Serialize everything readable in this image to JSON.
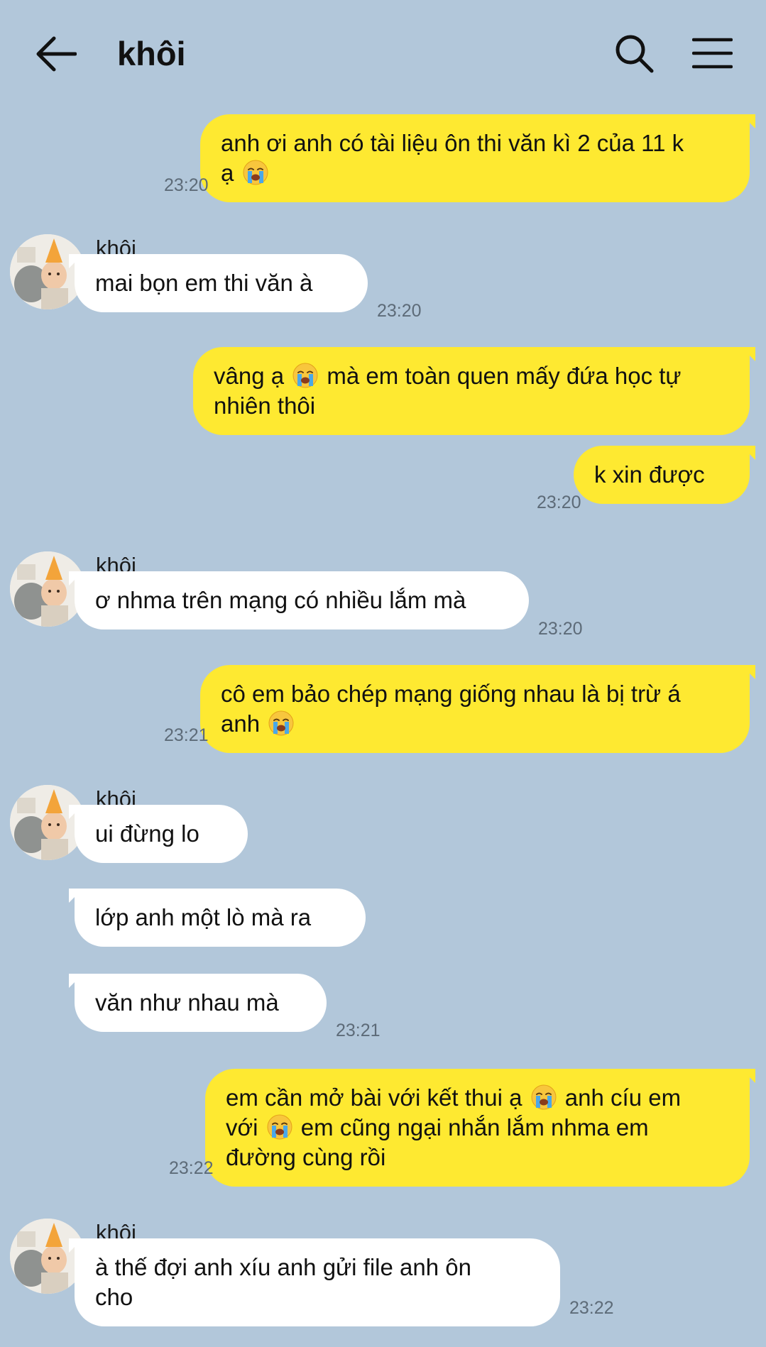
{
  "header": {
    "title": "khôi",
    "back_icon": "arrow-left-icon",
    "search_icon": "search-icon",
    "menu_icon": "hamburger-menu-icon"
  },
  "colors": {
    "background": "#b2c7da",
    "outgoing_bubble": "#fee931",
    "incoming_bubble": "#ffffff",
    "timestamp": "#5d6b78"
  },
  "messages": [
    {
      "dir": "out",
      "lines": [
        "anh ơi anh có tài liệu ôn thi văn kì 2 của 11 k",
        "ạ [cry]"
      ],
      "time": "23:20"
    },
    {
      "dir": "in",
      "sender": "khôi",
      "lines": [
        "mai bọn em thi văn à"
      ],
      "time": "23:20"
    },
    {
      "dir": "out",
      "lines": [
        "vâng ạ [cry] mà em toàn quen mấy đứa học tự",
        "nhiên thôi"
      ],
      "time": ""
    },
    {
      "dir": "out",
      "lines": [
        "k xin được"
      ],
      "time": "23:20"
    },
    {
      "dir": "in",
      "sender": "khôi",
      "lines": [
        "ơ nhma trên mạng có nhiều lắm mà"
      ],
      "time": "23:20"
    },
    {
      "dir": "out",
      "lines": [
        "cô em bảo chép mạng giống nhau là bị trừ á",
        "anh [cry]"
      ],
      "time": "23:21"
    },
    {
      "dir": "in",
      "sender": "khôi",
      "lines": [
        "ui đừng lo"
      ],
      "time": ""
    },
    {
      "dir": "in",
      "lines": [
        "lớp anh một lò mà ra"
      ],
      "time": ""
    },
    {
      "dir": "in",
      "lines": [
        "văn như nhau mà"
      ],
      "time": "23:21"
    },
    {
      "dir": "out",
      "lines": [
        "em cần mở bài với kết thui ạ [cry] anh cíu em",
        "với [cry] em cũng ngại nhắn lắm nhma em",
        "đường cùng rồi"
      ],
      "time": "23:22"
    },
    {
      "dir": "in",
      "sender": "khôi",
      "lines": [
        "à thế đợi anh xíu anh gửi file anh ôn",
        "cho"
      ],
      "time": "23:22"
    }
  ],
  "emoji": {
    "cry": "loudly-crying-face-emoji"
  }
}
